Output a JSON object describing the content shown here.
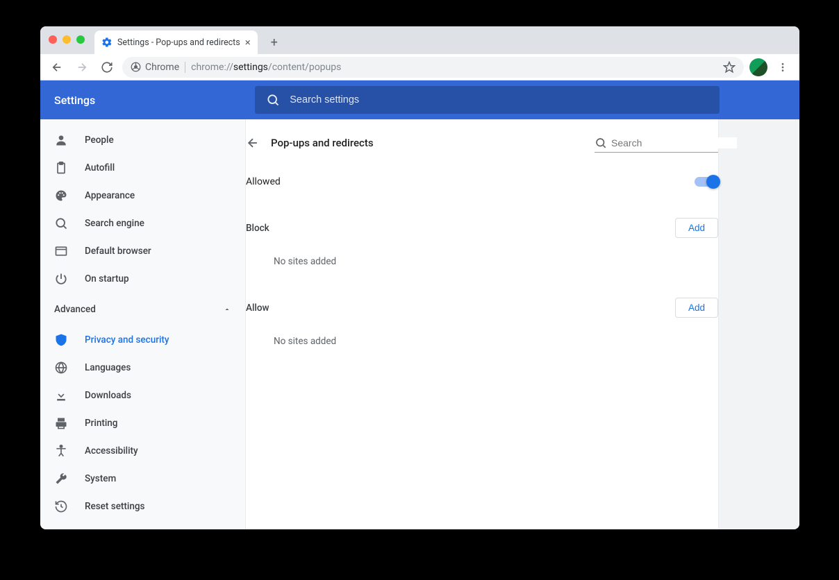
{
  "tab": {
    "title": "Settings - Pop-ups and redirects"
  },
  "omnibox": {
    "chip_label": "Chrome",
    "url_prefix": "chrome://",
    "url_bold": "settings",
    "url_suffix": "/content/popups"
  },
  "header": {
    "title": "Settings",
    "search_placeholder": "Search settings"
  },
  "sidebar": {
    "items_top": [
      {
        "label": "People"
      },
      {
        "label": "Autofill"
      },
      {
        "label": "Appearance"
      },
      {
        "label": "Search engine"
      },
      {
        "label": "Default browser"
      },
      {
        "label": "On startup"
      }
    ],
    "group_label": "Advanced",
    "items_adv": [
      {
        "label": "Privacy and security"
      },
      {
        "label": "Languages"
      },
      {
        "label": "Downloads"
      },
      {
        "label": "Printing"
      },
      {
        "label": "Accessibility"
      },
      {
        "label": "System"
      },
      {
        "label": "Reset settings"
      }
    ]
  },
  "page": {
    "title": "Pop-ups and redirects",
    "search_placeholder": "Search",
    "allowed_label": "Allowed",
    "block": {
      "title": "Block",
      "add": "Add",
      "empty": "No sites added"
    },
    "allow": {
      "title": "Allow",
      "add": "Add",
      "empty": "No sites added"
    }
  }
}
